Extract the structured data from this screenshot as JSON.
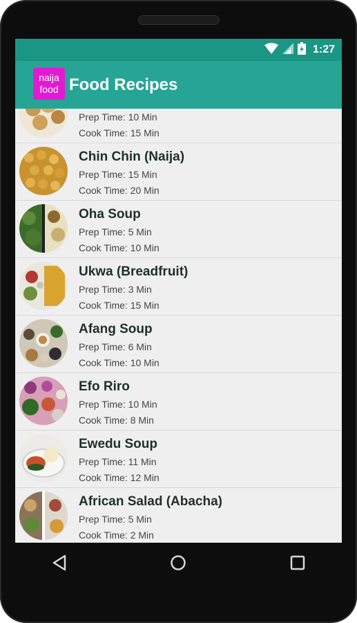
{
  "status_bar": {
    "time": "1:27",
    "icons": [
      "wifi-icon",
      "signal-icon",
      "battery-icon"
    ]
  },
  "app_bar": {
    "logo_line1": "naija",
    "logo_line2": "food",
    "title": "Food Recipes"
  },
  "recipes": [
    {
      "name": "",
      "prep": "Prep Time: 10 Min",
      "cook": "Cook Time: 15 Min"
    },
    {
      "name": "Chin Chin (Naija)",
      "prep": "Prep Time: 15 Min",
      "cook": "Cook Time: 20 Min"
    },
    {
      "name": "Oha Soup",
      "prep": "Prep Time: 5 Min",
      "cook": "Cook Time: 10 Min"
    },
    {
      "name": "Ukwa (Breadfruit)",
      "prep": "Prep Time: 3 Min",
      "cook": "Cook Time: 15 Min"
    },
    {
      "name": "Afang Soup",
      "prep": "Prep Time: 6 Min",
      "cook": "Cook Time: 10 Min"
    },
    {
      "name": "Efo Riro",
      "prep": "Prep Time: 10 Min",
      "cook": "Cook Time: 8 Min"
    },
    {
      "name": "Ewedu Soup",
      "prep": "Prep Time: 11 Min",
      "cook": "Cook Time: 12 Min"
    },
    {
      "name": "African Salad (Abacha)",
      "prep": "Prep Time: 5 Min",
      "cook": "Cook Time: 2 Min"
    }
  ],
  "nav_bar": {
    "buttons": [
      "back-icon",
      "home-icon",
      "recents-icon"
    ]
  },
  "colors": {
    "status_bar": "#1b9685",
    "app_bar": "#26a595",
    "logo": "#e21ad3",
    "list_background": "#efefef"
  }
}
